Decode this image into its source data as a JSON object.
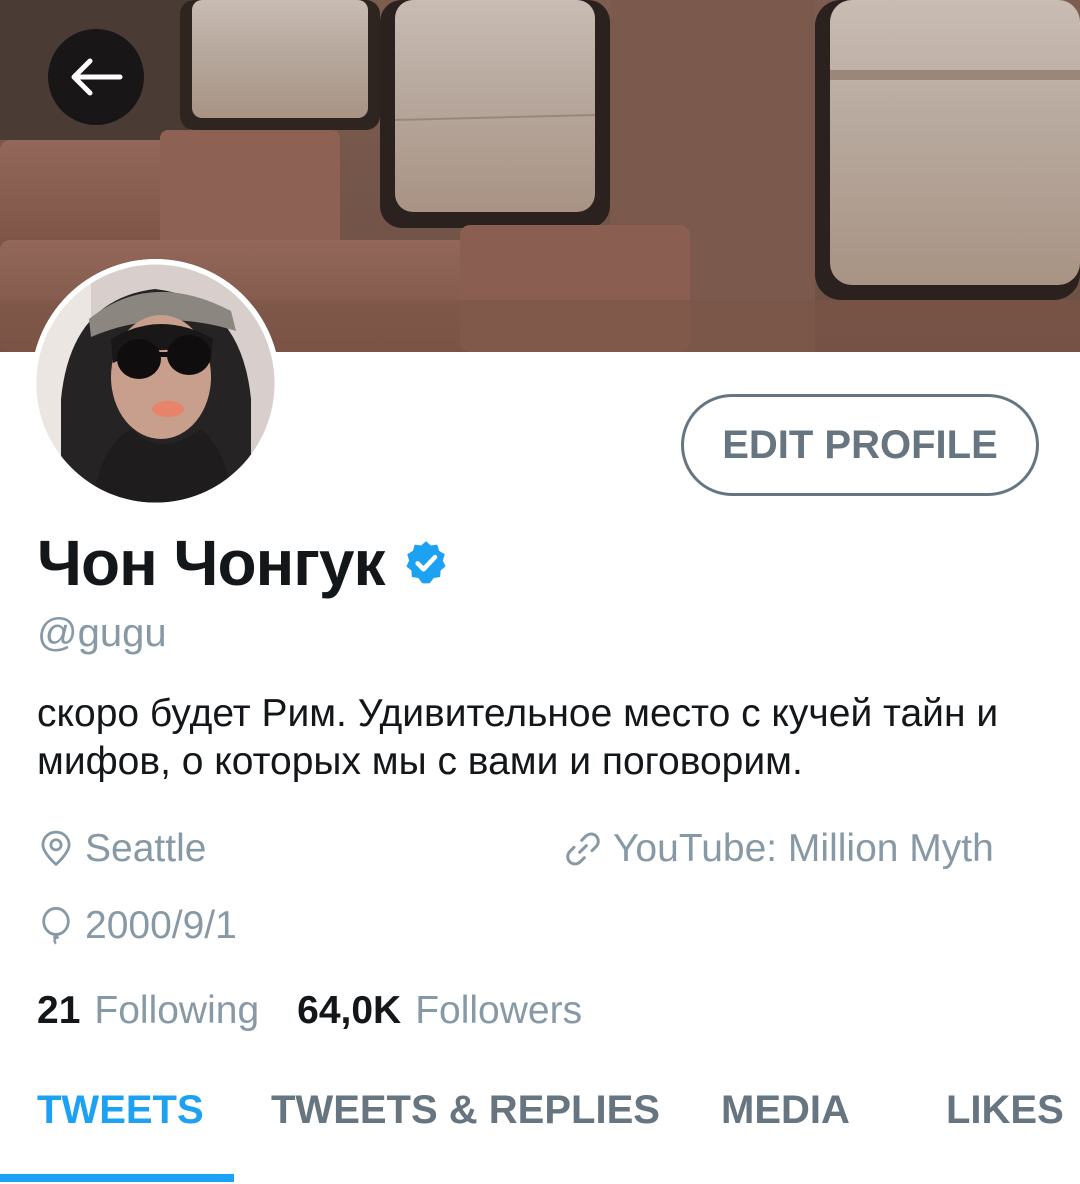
{
  "header": {
    "back_icon": "arrow-left-icon",
    "banner_icon": "train-interior-photo"
  },
  "profile": {
    "name": "Чон Чонгук",
    "verified_icon": "verified-badge-icon",
    "handle": "@gugu",
    "bio": "скоро будет Рим. Удивительное место с кучей тайн и мифов, о которых мы с вами и поговорим.",
    "location": "Seattle",
    "location_icon": "location-pin-icon",
    "website": "YouTube: Million Myth",
    "website_icon": "link-icon",
    "birthday": "2000/9/1",
    "birthday_icon": "balloon-icon",
    "edit_label": "EDIT PROFILE"
  },
  "stats": {
    "following_count": "21",
    "following_label": "Following",
    "followers_count": "64,0K",
    "followers_label": "Followers"
  },
  "tabs": [
    {
      "label": "TWEETS",
      "active": true
    },
    {
      "label": "TWEETS & REPLIES",
      "active": false
    },
    {
      "label": "MEDIA",
      "active": false
    },
    {
      "label": "LIKES",
      "active": false
    }
  ],
  "colors": {
    "accent": "#1da1f2",
    "muted_text": "#8899a6",
    "tab_text": "#66757f",
    "primary_text": "#14171a"
  }
}
